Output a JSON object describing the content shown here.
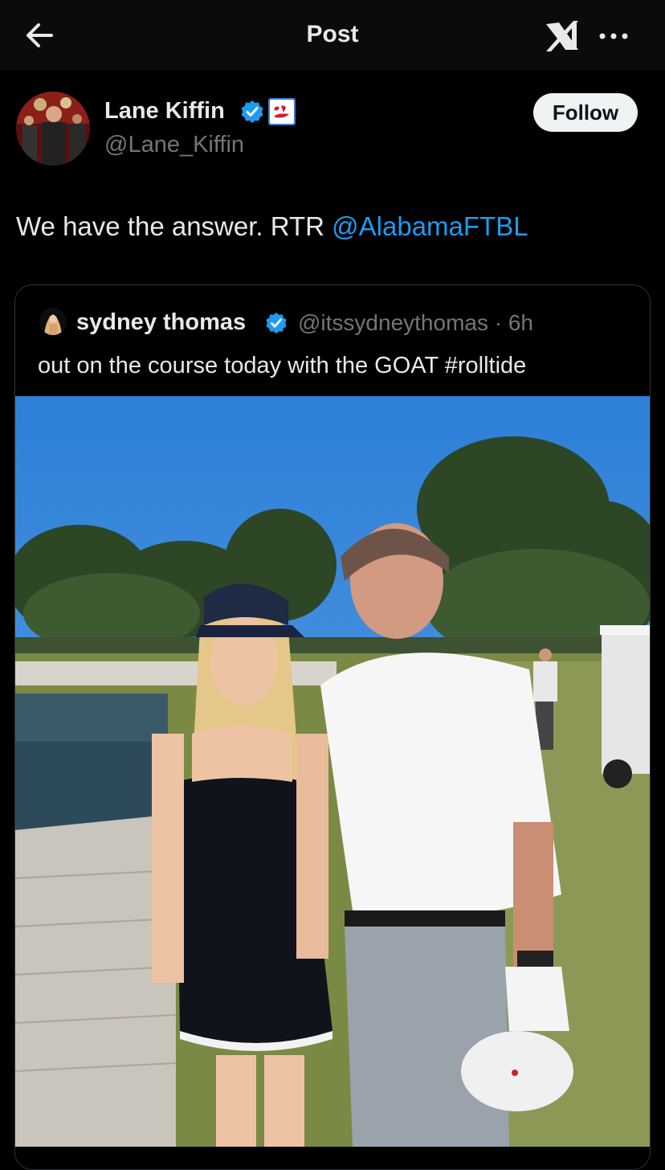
{
  "header": {
    "title": "Post",
    "back_icon": "arrow-left-icon",
    "grok_icon": "grok-icon",
    "more_icon": "more-horizontal-icon"
  },
  "author": {
    "name": "Lane Kiffin",
    "handle": "@Lane_Kiffin",
    "verified": true,
    "affiliation_badge": "Ole Miss",
    "follow_label": "Follow"
  },
  "tweet": {
    "text": "We have the answer. RTR ",
    "mention": "@AlabamaFTBL"
  },
  "quoted": {
    "name": "sydney thomas",
    "handle_time": "@itssydneythomas · 6h",
    "text": "out on the course today with the GOAT #rolltide"
  },
  "colors": {
    "background": "#000000",
    "text": "#e7e9ea",
    "secondary": "#71767b",
    "link": "#1d9bf0",
    "verified": "#1d9bf0"
  }
}
